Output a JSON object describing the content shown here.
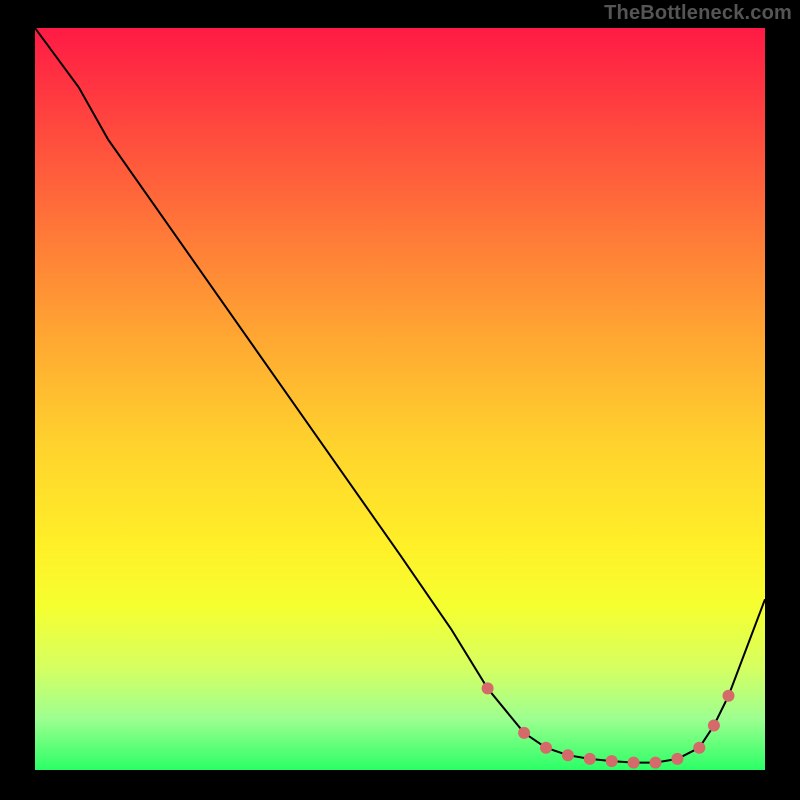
{
  "watermark": "TheBottleneck.com",
  "colors": {
    "background_black": "#000000",
    "curve_stroke": "#000000",
    "marker_fill": "#d46a6a",
    "gradient_stops": [
      {
        "offset": "0%",
        "color": "#ff1a45"
      },
      {
        "offset": "14%",
        "color": "#ff4a3e"
      },
      {
        "offset": "28%",
        "color": "#ff7a38"
      },
      {
        "offset": "42%",
        "color": "#ffa832"
      },
      {
        "offset": "56%",
        "color": "#ffd22d"
      },
      {
        "offset": "70%",
        "color": "#fff028"
      },
      {
        "offset": "78%",
        "color": "#f5ff30"
      },
      {
        "offset": "86%",
        "color": "#d7ff60"
      },
      {
        "offset": "93%",
        "color": "#9eff90"
      },
      {
        "offset": "100%",
        "color": "#2bff66"
      }
    ]
  },
  "chart_data": {
    "type": "line",
    "title": "",
    "xlabel": "",
    "ylabel": "",
    "xlim": [
      0,
      100
    ],
    "ylim": [
      0,
      100
    ],
    "series": [
      {
        "name": "bottleneck-curve",
        "x": [
          0,
          6,
          10,
          20,
          30,
          40,
          50,
          57,
          62,
          67,
          70,
          73,
          76,
          79,
          82,
          85,
          88,
          91,
          93,
          95,
          100
        ],
        "y": [
          100,
          92,
          85,
          71,
          57,
          43,
          29,
          19,
          11,
          5,
          3,
          2,
          1.5,
          1.2,
          1,
          1,
          1.5,
          3,
          6,
          10,
          23
        ]
      }
    ],
    "markers": {
      "name": "highlighted-points",
      "x": [
        62,
        67,
        70,
        73,
        76,
        79,
        82,
        85,
        88,
        91,
        93,
        95
      ],
      "y": [
        11,
        5,
        3,
        2,
        1.5,
        1.2,
        1,
        1,
        1.5,
        3,
        6,
        10
      ]
    }
  }
}
